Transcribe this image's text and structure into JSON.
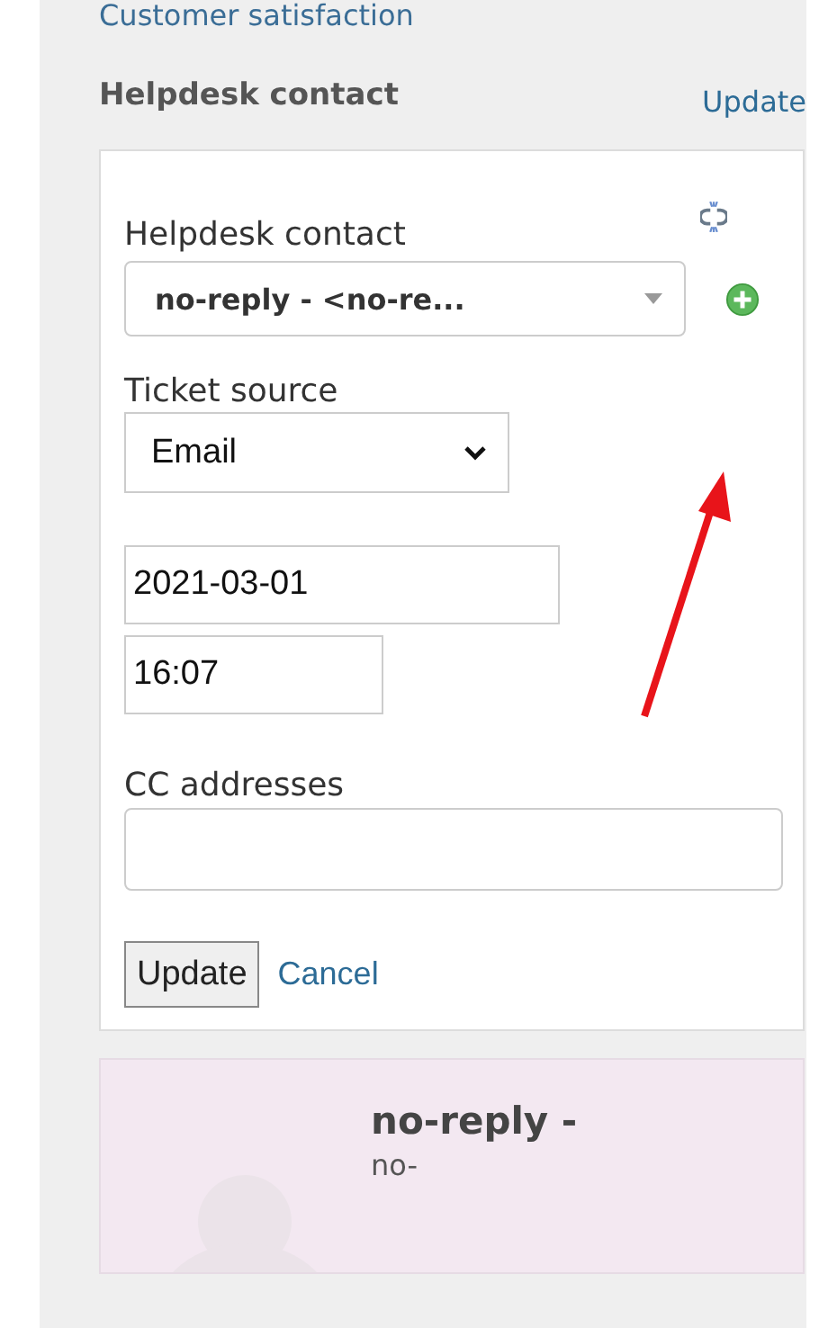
{
  "previous_section": {
    "title": "Customer satisfaction"
  },
  "section": {
    "title": "Helpdesk contact",
    "action": "Update"
  },
  "form": {
    "contact_label": "Helpdesk contact",
    "contact_value": "no-reply - <no-re...",
    "source_label": "Ticket source",
    "source_value": "Email",
    "date_value": "2021-03-01",
    "time_value": "16:07",
    "cc_label": "CC addresses",
    "submit": "Update",
    "cancel": "Cancel"
  },
  "contact_card": {
    "name": "no-reply -",
    "detail": "no-"
  }
}
